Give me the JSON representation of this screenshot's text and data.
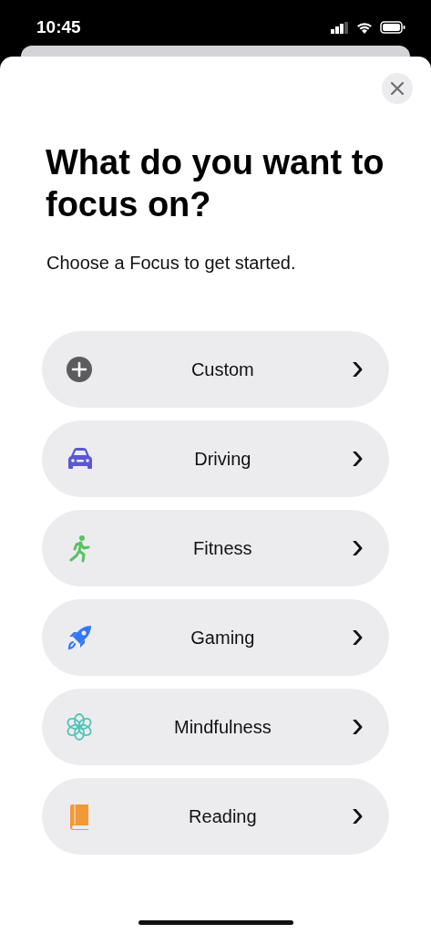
{
  "status_bar": {
    "time": "10:45"
  },
  "title": "What do you want to focus on?",
  "subtitle": "Choose a Focus to get started.",
  "options": [
    {
      "label": "Custom",
      "kind": "plus",
      "color": "#5c5c60",
      "chevron": "›"
    },
    {
      "label": "Driving",
      "kind": "car",
      "color": "#5a57d8",
      "chevron": "›"
    },
    {
      "label": "Fitness",
      "kind": "runner",
      "color": "#5cc064",
      "chevron": "›"
    },
    {
      "label": "Gaming",
      "kind": "rocket",
      "color": "#3478f6",
      "chevron": "›"
    },
    {
      "label": "Mindfulness",
      "kind": "flower",
      "color": "#52c5b8",
      "chevron": "›"
    },
    {
      "label": "Reading",
      "kind": "book",
      "color": "#f09a37",
      "chevron": "›"
    }
  ]
}
